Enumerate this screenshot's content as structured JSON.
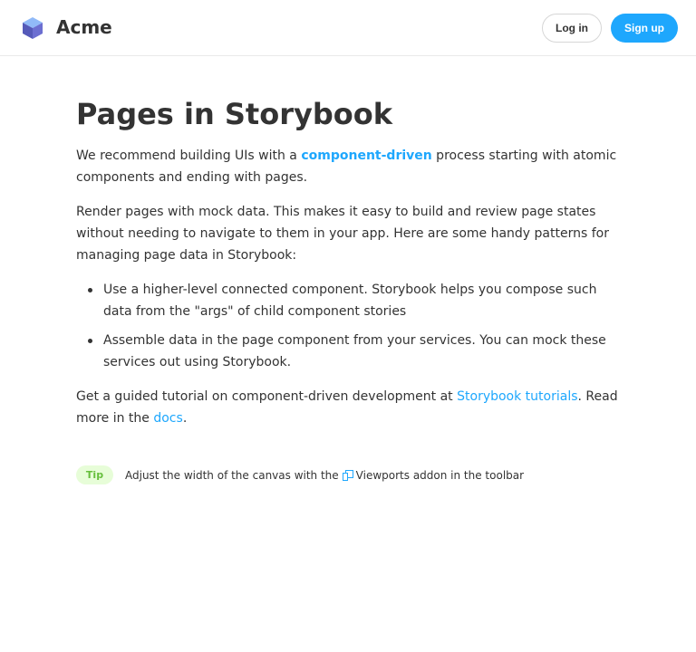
{
  "header": {
    "brand": "Acme",
    "login_label": "Log in",
    "signup_label": "Sign up",
    "logo_icon": "cube-logo-icon",
    "colors": {
      "primary": "#1ea7fd",
      "logo_dark": "#555ab9",
      "logo_mid": "#91baf8",
      "logo_light": "#6c6fd1"
    }
  },
  "main": {
    "title": "Pages in Storybook",
    "p1": {
      "before": "We recommend building UIs with a ",
      "link": "component-driven",
      "after": " process starting with atomic components and ending with pages."
    },
    "p2": "Render pages with mock data. This makes it easy to build and review page states without needing to navigate to them in your app. Here are some handy patterns for managing page data in Storybook:",
    "list": [
      "Use a higher-level connected component. Storybook helps you compose such data from the \"args\" of child component stories",
      "Assemble data in the page component from your services. You can mock these services out using Storybook."
    ],
    "p3": {
      "before": "Get a guided tutorial on component-driven development at ",
      "link1": "Storybook tutorials",
      "middle": ". Read more in the ",
      "link2": "docs",
      "after": "."
    }
  },
  "tip": {
    "badge": "Tip",
    "text_before": "Adjust the width of the canvas with the",
    "text_after": "Viewports addon in the toolbar",
    "icon": "viewports-icon",
    "colors": {
      "badge_bg": "#e7fdd8",
      "badge_text": "#66bf3c"
    }
  }
}
